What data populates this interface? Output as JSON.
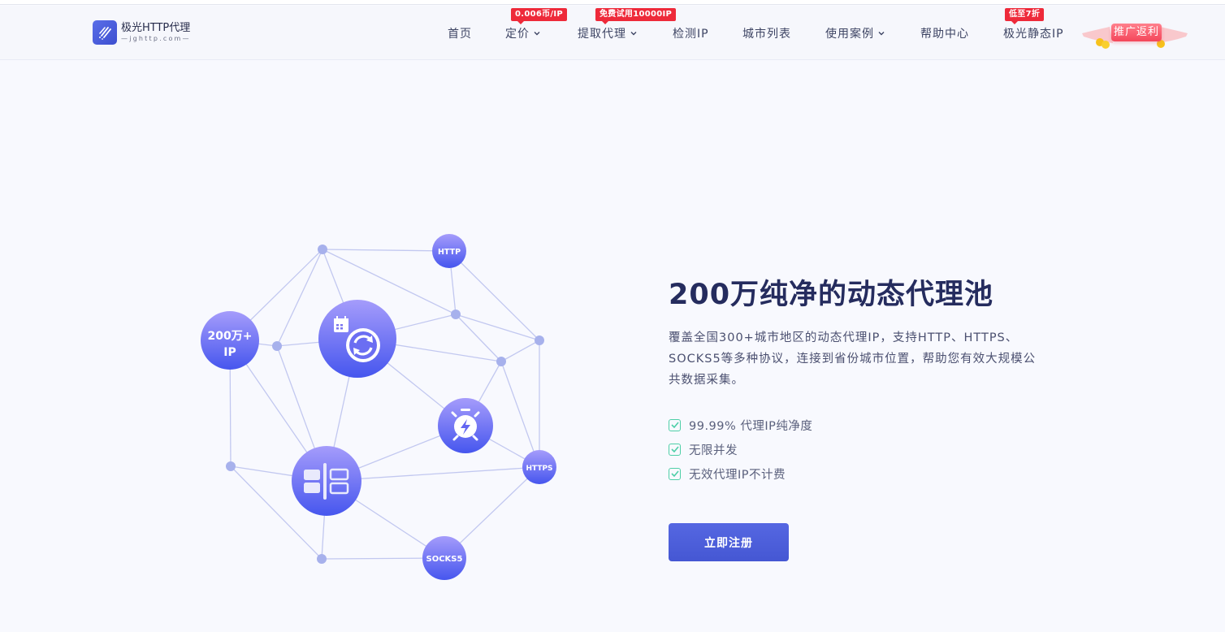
{
  "header": {
    "logo": {
      "title": "极光HTTP代理",
      "subtitle": "—jghttp.com—",
      "icon": "comet-lines-icon"
    },
    "nav": [
      {
        "label": "首页",
        "has_dropdown": false,
        "badge": null
      },
      {
        "label": "定价",
        "has_dropdown": true,
        "badge": "0.006币/IP"
      },
      {
        "label": "提取代理",
        "has_dropdown": true,
        "badge": "免费试用10000IP"
      },
      {
        "label": "检测IP",
        "has_dropdown": false,
        "badge": null
      },
      {
        "label": "城市列表",
        "has_dropdown": false,
        "badge": null
      },
      {
        "label": "使用案例",
        "has_dropdown": true,
        "badge": null
      },
      {
        "label": "帮助中心",
        "has_dropdown": false,
        "badge": null
      },
      {
        "label": "极光静态IP",
        "has_dropdown": false,
        "badge": "低至7折"
      }
    ],
    "promo": {
      "label": "推广返利"
    }
  },
  "hero": {
    "title": "200万纯净的动态代理池",
    "description": "覆盖全国300+城市地区的动态代理IP，支持HTTP、HTTPS、SOCKS5等多种协议，连接到省份城市位置，帮助您有效大规模公共数据采集。",
    "features": [
      "99.99% 代理IP纯净度",
      "无限并发",
      "无效代理IP不计费"
    ],
    "cta_label": "立即注册"
  },
  "network": {
    "nodes": {
      "ip_pool": {
        "line1": "200万+",
        "line2": "IP"
      },
      "http": {
        "label": "HTTP"
      },
      "https": {
        "label": "HTTPS"
      },
      "socks5": {
        "label": "SOCKS5"
      },
      "rotate": {
        "icon": "calendar-rotate-icon"
      },
      "speed": {
        "icon": "stopwatch-lightning-icon"
      },
      "layout": {
        "icon": "layout-panels-icon"
      }
    }
  },
  "colors": {
    "brand": "#4a5cd8",
    "badge_red": "#ee2a3a",
    "title": "#252c5e",
    "check_green": "#4fcfa8",
    "node_top": "#a198fb",
    "node_bottom": "#4858ee",
    "line": "#c2c8f0",
    "dot": "#a7b1ec"
  }
}
